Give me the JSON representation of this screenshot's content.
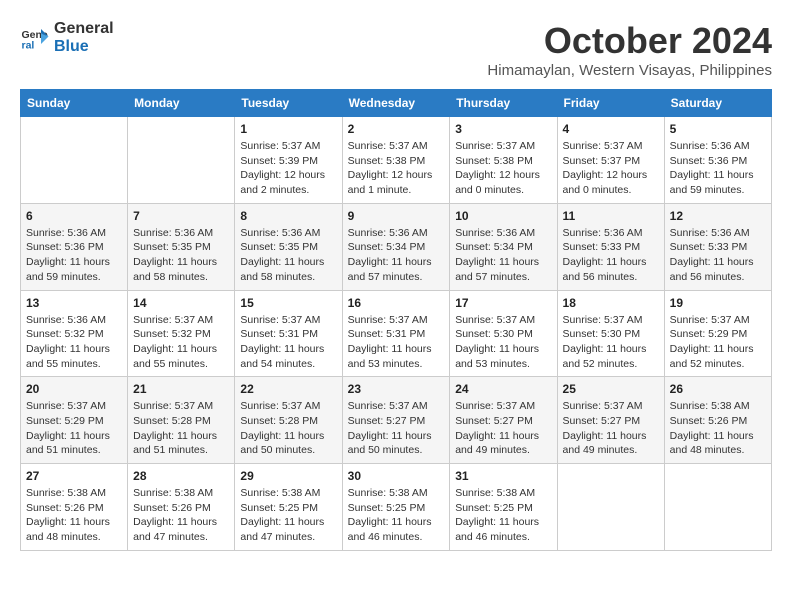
{
  "logo": {
    "line1": "General",
    "line2": "Blue"
  },
  "title": "October 2024",
  "subtitle": "Himamaylan, Western Visayas, Philippines",
  "days_header": [
    "Sunday",
    "Monday",
    "Tuesday",
    "Wednesday",
    "Thursday",
    "Friday",
    "Saturday"
  ],
  "weeks": [
    [
      {
        "num": "",
        "info": ""
      },
      {
        "num": "",
        "info": ""
      },
      {
        "num": "1",
        "info": "Sunrise: 5:37 AM\nSunset: 5:39 PM\nDaylight: 12 hours\nand 2 minutes."
      },
      {
        "num": "2",
        "info": "Sunrise: 5:37 AM\nSunset: 5:38 PM\nDaylight: 12 hours\nand 1 minute."
      },
      {
        "num": "3",
        "info": "Sunrise: 5:37 AM\nSunset: 5:38 PM\nDaylight: 12 hours\nand 0 minutes."
      },
      {
        "num": "4",
        "info": "Sunrise: 5:37 AM\nSunset: 5:37 PM\nDaylight: 12 hours\nand 0 minutes."
      },
      {
        "num": "5",
        "info": "Sunrise: 5:36 AM\nSunset: 5:36 PM\nDaylight: 11 hours\nand 59 minutes."
      }
    ],
    [
      {
        "num": "6",
        "info": "Sunrise: 5:36 AM\nSunset: 5:36 PM\nDaylight: 11 hours\nand 59 minutes."
      },
      {
        "num": "7",
        "info": "Sunrise: 5:36 AM\nSunset: 5:35 PM\nDaylight: 11 hours\nand 58 minutes."
      },
      {
        "num": "8",
        "info": "Sunrise: 5:36 AM\nSunset: 5:35 PM\nDaylight: 11 hours\nand 58 minutes."
      },
      {
        "num": "9",
        "info": "Sunrise: 5:36 AM\nSunset: 5:34 PM\nDaylight: 11 hours\nand 57 minutes."
      },
      {
        "num": "10",
        "info": "Sunrise: 5:36 AM\nSunset: 5:34 PM\nDaylight: 11 hours\nand 57 minutes."
      },
      {
        "num": "11",
        "info": "Sunrise: 5:36 AM\nSunset: 5:33 PM\nDaylight: 11 hours\nand 56 minutes."
      },
      {
        "num": "12",
        "info": "Sunrise: 5:36 AM\nSunset: 5:33 PM\nDaylight: 11 hours\nand 56 minutes."
      }
    ],
    [
      {
        "num": "13",
        "info": "Sunrise: 5:36 AM\nSunset: 5:32 PM\nDaylight: 11 hours\nand 55 minutes."
      },
      {
        "num": "14",
        "info": "Sunrise: 5:37 AM\nSunset: 5:32 PM\nDaylight: 11 hours\nand 55 minutes."
      },
      {
        "num": "15",
        "info": "Sunrise: 5:37 AM\nSunset: 5:31 PM\nDaylight: 11 hours\nand 54 minutes."
      },
      {
        "num": "16",
        "info": "Sunrise: 5:37 AM\nSunset: 5:31 PM\nDaylight: 11 hours\nand 53 minutes."
      },
      {
        "num": "17",
        "info": "Sunrise: 5:37 AM\nSunset: 5:30 PM\nDaylight: 11 hours\nand 53 minutes."
      },
      {
        "num": "18",
        "info": "Sunrise: 5:37 AM\nSunset: 5:30 PM\nDaylight: 11 hours\nand 52 minutes."
      },
      {
        "num": "19",
        "info": "Sunrise: 5:37 AM\nSunset: 5:29 PM\nDaylight: 11 hours\nand 52 minutes."
      }
    ],
    [
      {
        "num": "20",
        "info": "Sunrise: 5:37 AM\nSunset: 5:29 PM\nDaylight: 11 hours\nand 51 minutes."
      },
      {
        "num": "21",
        "info": "Sunrise: 5:37 AM\nSunset: 5:28 PM\nDaylight: 11 hours\nand 51 minutes."
      },
      {
        "num": "22",
        "info": "Sunrise: 5:37 AM\nSunset: 5:28 PM\nDaylight: 11 hours\nand 50 minutes."
      },
      {
        "num": "23",
        "info": "Sunrise: 5:37 AM\nSunset: 5:27 PM\nDaylight: 11 hours\nand 50 minutes."
      },
      {
        "num": "24",
        "info": "Sunrise: 5:37 AM\nSunset: 5:27 PM\nDaylight: 11 hours\nand 49 minutes."
      },
      {
        "num": "25",
        "info": "Sunrise: 5:37 AM\nSunset: 5:27 PM\nDaylight: 11 hours\nand 49 minutes."
      },
      {
        "num": "26",
        "info": "Sunrise: 5:38 AM\nSunset: 5:26 PM\nDaylight: 11 hours\nand 48 minutes."
      }
    ],
    [
      {
        "num": "27",
        "info": "Sunrise: 5:38 AM\nSunset: 5:26 PM\nDaylight: 11 hours\nand 48 minutes."
      },
      {
        "num": "28",
        "info": "Sunrise: 5:38 AM\nSunset: 5:26 PM\nDaylight: 11 hours\nand 47 minutes."
      },
      {
        "num": "29",
        "info": "Sunrise: 5:38 AM\nSunset: 5:25 PM\nDaylight: 11 hours\nand 47 minutes."
      },
      {
        "num": "30",
        "info": "Sunrise: 5:38 AM\nSunset: 5:25 PM\nDaylight: 11 hours\nand 46 minutes."
      },
      {
        "num": "31",
        "info": "Sunrise: 5:38 AM\nSunset: 5:25 PM\nDaylight: 11 hours\nand 46 minutes."
      },
      {
        "num": "",
        "info": ""
      },
      {
        "num": "",
        "info": ""
      }
    ]
  ]
}
